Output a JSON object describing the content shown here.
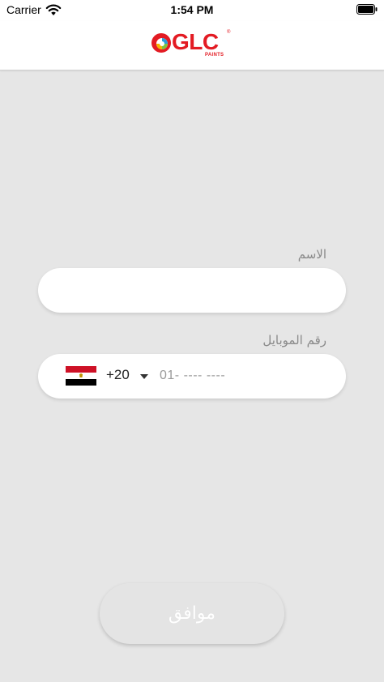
{
  "status_bar": {
    "carrier": "Carrier",
    "time": "1:54 PM"
  },
  "header": {
    "logo": {
      "text": "GLC",
      "subtext": "PAINTS",
      "registered": "®",
      "color": "#e31b23"
    }
  },
  "form": {
    "name": {
      "label": "الاسم",
      "value": "",
      "placeholder": ""
    },
    "mobile": {
      "label": "رقم الموبايل",
      "country_flag": "egypt-flag-icon",
      "country_code": "+20",
      "value": "",
      "placeholder": "01- ---- ----"
    },
    "submit_label": "موافق"
  }
}
